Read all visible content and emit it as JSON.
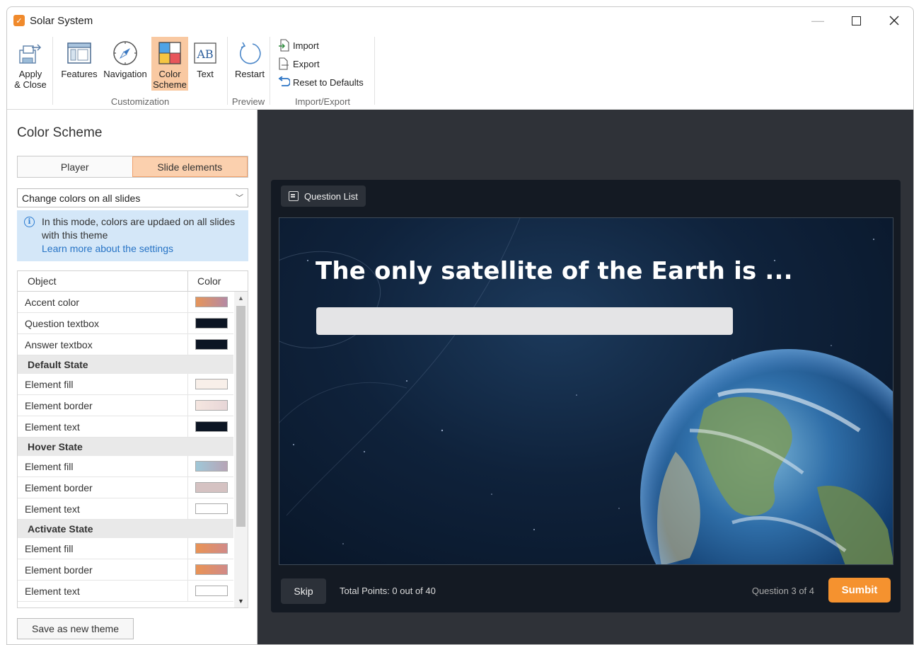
{
  "window": {
    "title": "Solar System"
  },
  "ribbon": {
    "buttons": {
      "apply_close": "Apply\n& Close",
      "features": "Features",
      "navigation": "Navigation",
      "color_scheme": "Color\nScheme",
      "text": "Text",
      "restart": "Restart",
      "import": "Import",
      "export": "Export",
      "reset": "Reset to Defaults"
    },
    "groups": {
      "customization": "Customization",
      "preview": "Preview",
      "import_export": "Import/Export"
    },
    "active_button": "color_scheme"
  },
  "panel": {
    "title": "Color Scheme",
    "tabs": [
      {
        "label": "Player",
        "active": false
      },
      {
        "label": "Slide elements",
        "active": true
      }
    ],
    "mode_select": {
      "value": "Change colors on all slides"
    },
    "info": {
      "text": "In this mode, colors are updaed on all slides with this theme",
      "link": "Learn more about the settings"
    },
    "table": {
      "headers": {
        "object": "Object",
        "color": "Color"
      },
      "rows": [
        {
          "label": "Accent color",
          "color": "linear-gradient(90deg,#e6955a,#b489a4)"
        },
        {
          "label": "Question textbox",
          "color": "#0c1523"
        },
        {
          "label": "Answer textbox",
          "color": "#0c1523"
        },
        {
          "group": "Default State"
        },
        {
          "label": "Element fill",
          "color": "#f8efe9"
        },
        {
          "label": "Element border",
          "color": "linear-gradient(90deg,#f5e6e0,#e7d6d7)"
        },
        {
          "label": "Element text",
          "color": "#0c1523"
        },
        {
          "group": "Hover State"
        },
        {
          "label": "Element fill",
          "color": "linear-gradient(90deg,#9fc8d8,#b7a4b6)"
        },
        {
          "label": "Element border",
          "color": "#d5c2c2"
        },
        {
          "label": "Element text",
          "color": "#ffffff"
        },
        {
          "group": "Activate State"
        },
        {
          "label": "Element fill",
          "color": "linear-gradient(90deg,#e99355,#d18a88)"
        },
        {
          "label": "Element border",
          "color": "linear-gradient(90deg,#e99355,#d18a88)"
        },
        {
          "label": "Element text",
          "color": "#ffffff"
        }
      ]
    },
    "save_button": "Save as new theme"
  },
  "preview": {
    "question_list_label": "Question List",
    "slide_title": "The only satellite of the Earth is ...",
    "skip_label": "Skip",
    "points_label": "Total Points: 0 out of 40",
    "question_counter": "Question 3 of 4",
    "submit_label": "Sumbit"
  },
  "colors": {
    "accent": "#f5922f",
    "active_tab": "#fbd0ae",
    "info_bg": "#d4e7f8",
    "preview_bg": "#2f3238"
  }
}
